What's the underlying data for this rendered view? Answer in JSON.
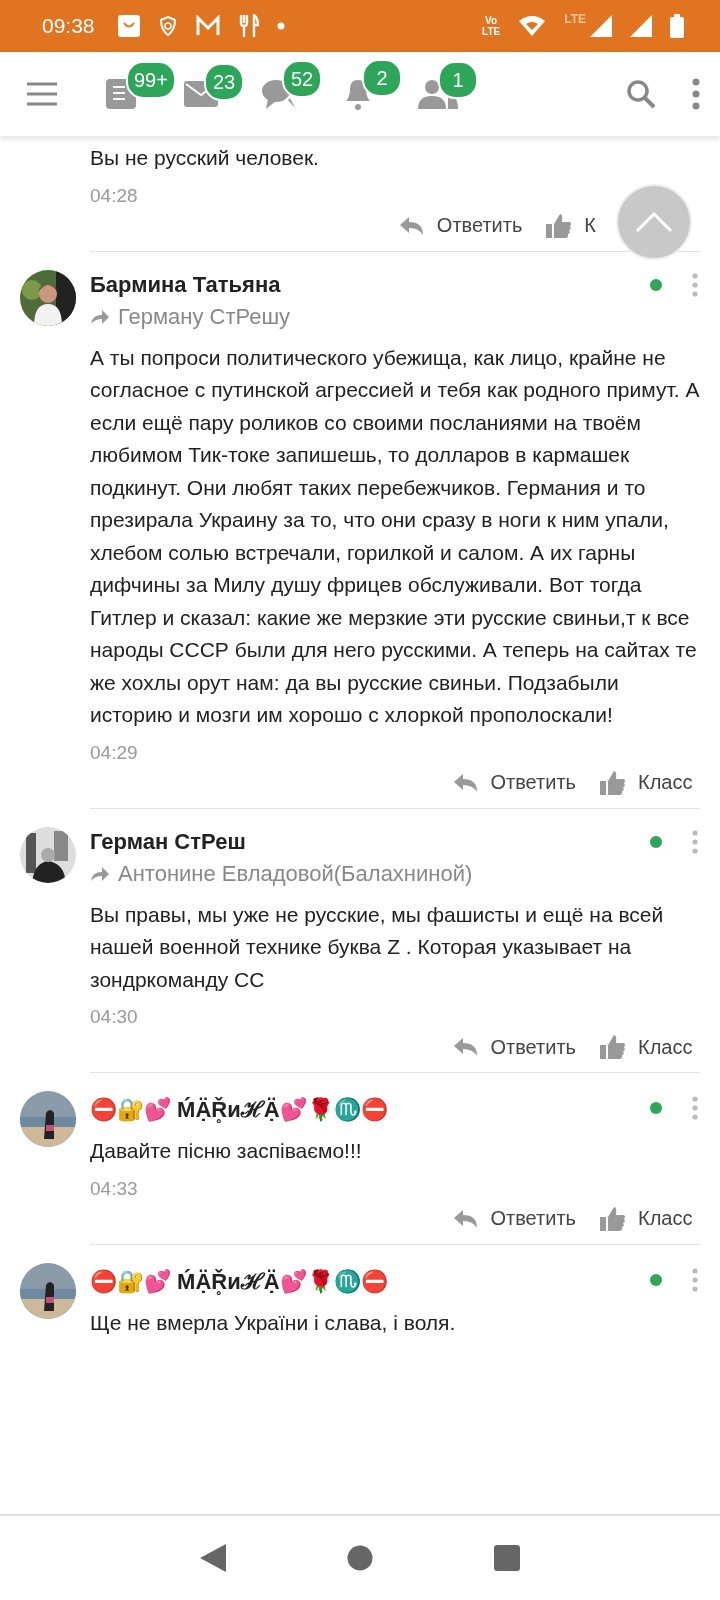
{
  "status_bar": {
    "time": "09:38",
    "volte": [
      "Vo",
      "LTE"
    ],
    "network": "LTE"
  },
  "header": {
    "badges": [
      {
        "count": "99+"
      },
      {
        "count": "23"
      },
      {
        "count": "52"
      },
      {
        "count": "2"
      },
      {
        "count": "1"
      }
    ]
  },
  "comments": [
    {
      "kind": "partial",
      "text": "Вы не русский человек.",
      "time": "04:28",
      "reply": "Ответить",
      "like": "К"
    },
    {
      "kind": "full",
      "author": "Бармина Татьяна",
      "reply_to": "Герману СтРешу",
      "online": true,
      "text": "А ты попроси политического убежища, как лицо, крайне не согласное с путинской агрессией и тебя как родного примут. А если ещё пару роликов со своими посланиями на твоём любимом Тик-токе запишешь, то долларов в кармашек подкинут. Они любят таких перебежчиков. Германия и то презирала Украину за то, что они сразу в ноги к ним упали, хлебом солью встречали, горилкой и салом. А их гарны дифчины за Милу душу фрицев обслуживали. Вот тогда Гитлер и сказал: какие же мерзкие эти русские свиньи,т к все народы СССР были для него русскими. А теперь на сайтах те же хохлы орут нам: да вы русские свиньи. Подзабыли историю и мозги им хорошо с хлоркой прополоскали!",
      "time": "04:29",
      "reply": "Ответить",
      "like": "Класс"
    },
    {
      "kind": "full",
      "author": "Герман СтРеш",
      "reply_to": "Антонине Евладовой(Балахниной)",
      "online": true,
      "text": "Вы правы, мы уже не русские, мы фашисты и ещё на всей нашей военной технике буква Z . Которая указывает на зондркоманду  СС",
      "time": "04:30",
      "reply": "Ответить",
      "like": "Класс"
    },
    {
      "kind": "full",
      "author": "⛔🔐💕 ḾẠ̈Ř̥иℋẠ̈💕🌹♏⛔",
      "online": true,
      "text": "Давайте пісню заспіваємо!!!",
      "time": "04:33",
      "reply": "Ответить",
      "like": "Класс"
    },
    {
      "kind": "cut",
      "author": "⛔🔐💕 ḾẠ̈Ř̥иℋẠ̈💕🌹♏⛔",
      "online": true,
      "text": "Ще не вмерла України і слава, і воля."
    }
  ]
}
